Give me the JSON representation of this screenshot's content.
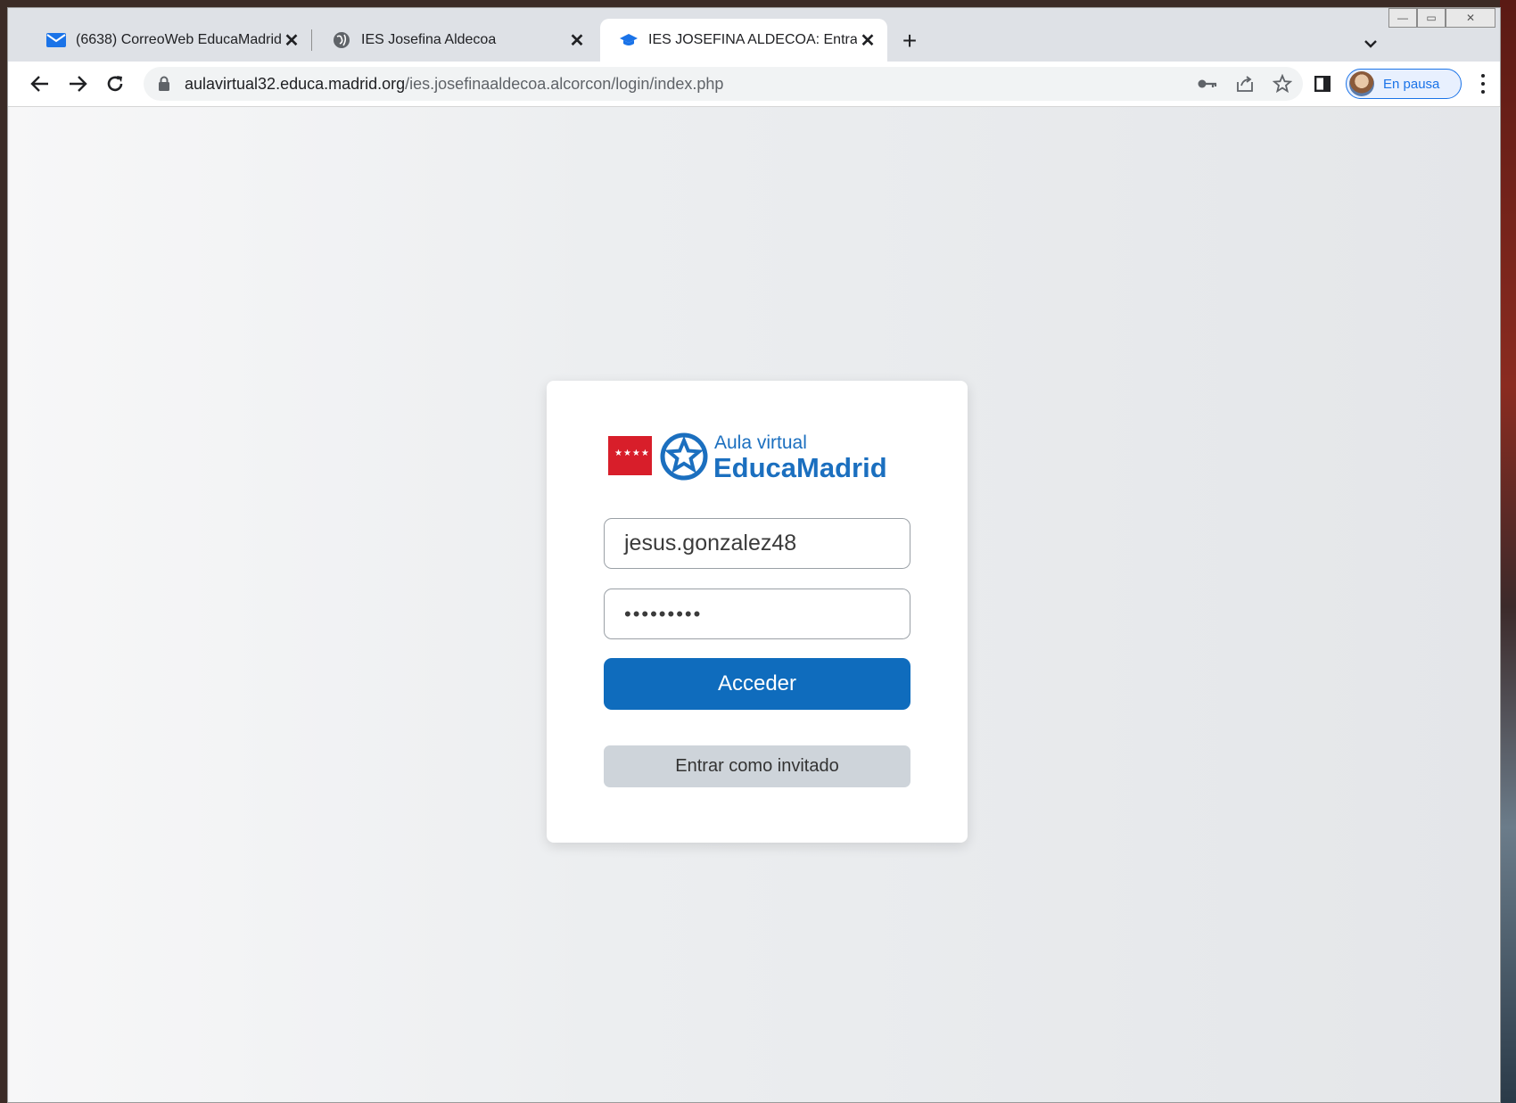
{
  "tabs": [
    {
      "title": "(6638) CorreoWeb EducaMadrid",
      "icon": "mail-icon"
    },
    {
      "title": "IES Josefina Aldecoa",
      "icon": "globe-icon"
    },
    {
      "title": "IES JOSEFINA ALDECOA: Entrar a",
      "icon": "graduation-cap-icon",
      "active": true
    }
  ],
  "address_bar": {
    "host": "aulavirtual32.educa.madrid.org",
    "path": "/ies.josefinaaldecoa.alcorcon/login/index.php"
  },
  "profile": {
    "label": "En pausa"
  },
  "login": {
    "logo_line1": "Aula virtual",
    "logo_line2": "EducaMadrid",
    "username_value": "jesus.gonzalez48",
    "password_mask": "•••••••••",
    "submit_label": "Acceder",
    "guest_label": "Entrar como invitado"
  },
  "colors": {
    "accent": "#0f6cbd",
    "brand_red": "#d81e2a",
    "brand_blue": "#1b6fbf",
    "guest_button": "#ced4da"
  }
}
